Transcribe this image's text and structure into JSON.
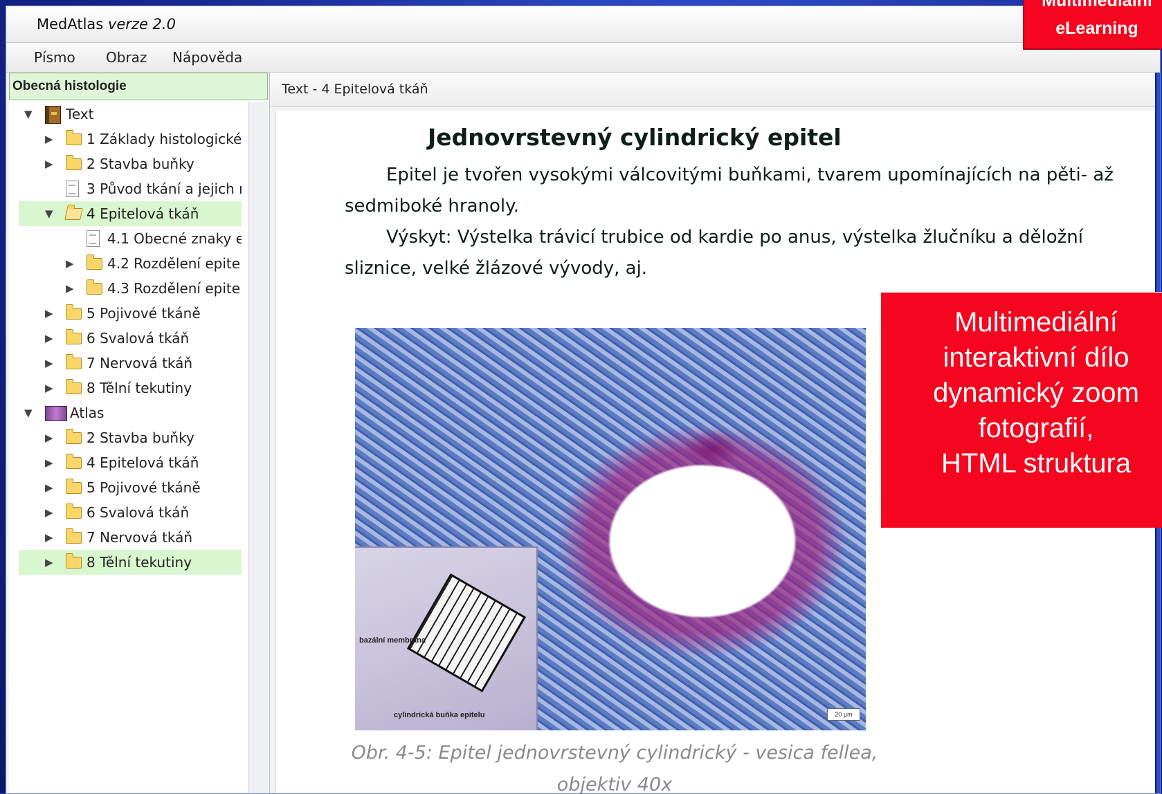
{
  "window": {
    "app_name": "MedAtlas",
    "app_version": "verze 2.0"
  },
  "menu": {
    "items": [
      "Písmo",
      "Obraz",
      "Nápověda"
    ]
  },
  "sidebar": {
    "header": "Obecná histologie",
    "tree": [
      {
        "label": "Text",
        "icon": "book-icon",
        "arrow": "▼",
        "depth": 0,
        "selected": false
      },
      {
        "label": "1 Základy histologické",
        "icon": "folder-icon",
        "arrow": "▶",
        "depth": 1,
        "selected": false
      },
      {
        "label": "2 Stavba buňky",
        "icon": "folder-icon",
        "arrow": "▶",
        "depth": 1,
        "selected": false
      },
      {
        "label": "3 Původ tkání a jejich r",
        "icon": "document-icon",
        "arrow": "",
        "depth": 1,
        "selected": false
      },
      {
        "label": "4 Epitelová tkáň",
        "icon": "folder-open-icon",
        "arrow": "▼",
        "depth": 1,
        "selected": true
      },
      {
        "label": "4.1 Obecné znaky e",
        "icon": "document-icon",
        "arrow": "",
        "depth": 2,
        "selected": false
      },
      {
        "label": "4.2 Rozdělení epite",
        "icon": "folder-icon",
        "arrow": "▶",
        "depth": 2,
        "selected": false
      },
      {
        "label": "4.3 Rozdělení epite",
        "icon": "folder-icon",
        "arrow": "▶",
        "depth": 2,
        "selected": false
      },
      {
        "label": "5 Pojivové tkáně",
        "icon": "folder-icon",
        "arrow": "▶",
        "depth": 1,
        "selected": false
      },
      {
        "label": "6 Svalová tkáň",
        "icon": "folder-icon",
        "arrow": "▶",
        "depth": 1,
        "selected": false
      },
      {
        "label": "7 Nervová tkáň",
        "icon": "folder-icon",
        "arrow": "▶",
        "depth": 1,
        "selected": false
      },
      {
        "label": "8 Tělní tekutiny",
        "icon": "folder-icon",
        "arrow": "▶",
        "depth": 1,
        "selected": false
      },
      {
        "label": "Atlas",
        "icon": "atlas-icon",
        "arrow": "▼",
        "depth": 0,
        "selected": false
      },
      {
        "label": "2 Stavba buňky",
        "icon": "folder-icon",
        "arrow": "▶",
        "depth": 1,
        "selected": false
      },
      {
        "label": "4 Epitelová tkáň",
        "icon": "folder-icon",
        "arrow": "▶",
        "depth": 1,
        "selected": false
      },
      {
        "label": "5 Pojivové tkáně",
        "icon": "folder-icon",
        "arrow": "▶",
        "depth": 1,
        "selected": false
      },
      {
        "label": "6 Svalová tkáň",
        "icon": "folder-icon",
        "arrow": "▶",
        "depth": 1,
        "selected": false
      },
      {
        "label": "7 Nervová tkáň",
        "icon": "folder-icon",
        "arrow": "▶",
        "depth": 1,
        "selected": false
      },
      {
        "label": "8 Tělní tekutiny",
        "icon": "folder-icon",
        "arrow": "▶",
        "depth": 1,
        "selected": true
      }
    ]
  },
  "content": {
    "header": "Text - 4 Epitelová tkáň",
    "heading": "Jednovrstevný cylindrický epitel",
    "paragraph_1": "Epitel je tvořen vysokými válcovitými buňkami, tvarem upomínajících na pěti- až sedmiboké hranoly.",
    "paragraph_2": "Výskyt: Výstelka trávicí trubice od kardie po anus, výstelka žlučníku a děložní sliznice, velké žlázové vývody, aj.",
    "figure": {
      "label_basal": "bazální membrána",
      "label_cell": "cylindrická buňka epitelu",
      "scale": "20 μm",
      "caption": "Obr. 4-5: Epitel jednovrstevný cylindrický - vesica fellea, objektiv 40x"
    }
  },
  "overlay": {
    "badge_line1": "Multimediální",
    "badge_line2": "eLearning",
    "promo_lines": [
      "Multimediální",
      "interaktivní dílo",
      "dynamický zoom",
      "fotografií,",
      "HTML struktura"
    ]
  },
  "colors": {
    "slide_background": "#1a2fa0",
    "promo_red": "#f5051e",
    "selection_green": "#d9f7cf"
  }
}
